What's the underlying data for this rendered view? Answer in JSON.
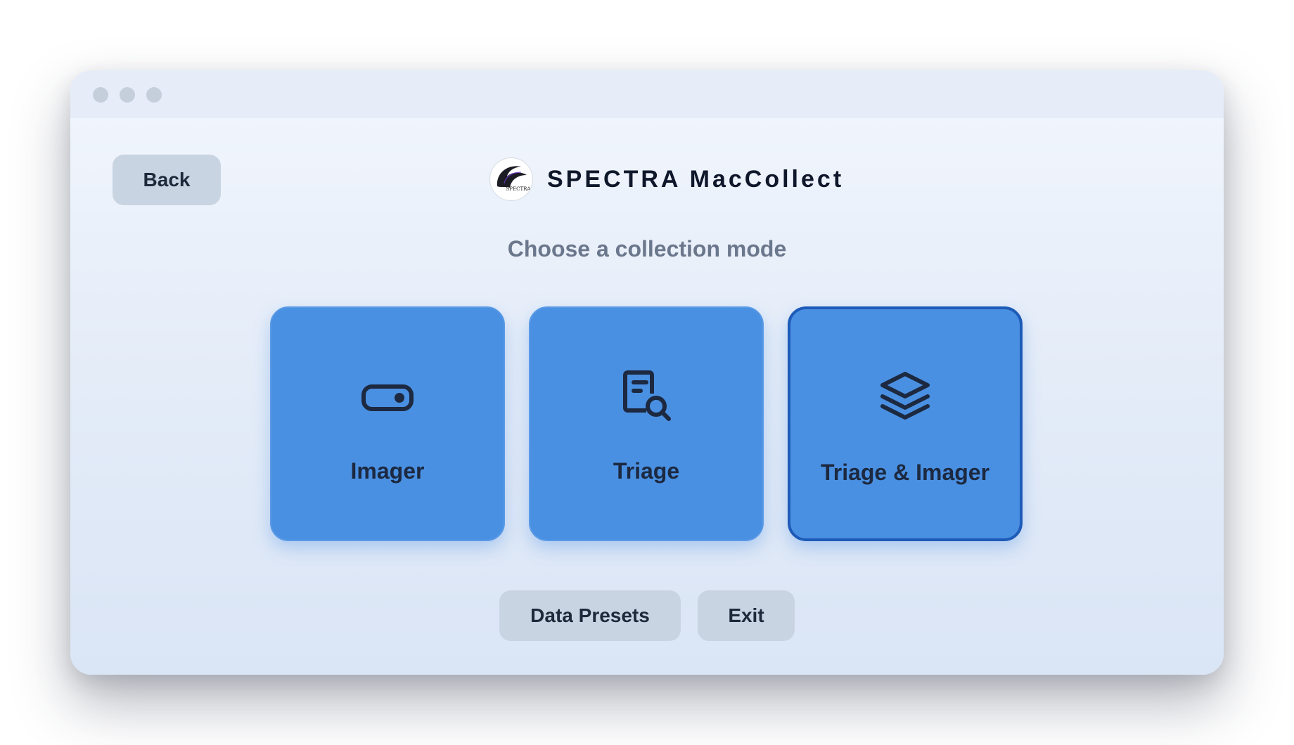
{
  "window": {
    "traffic_lights": [
      "close-dot",
      "minimize-dot",
      "zoom-dot"
    ]
  },
  "header": {
    "back_label": "Back",
    "logo_text": "SPECTRA",
    "app_title": "SPECTRA MacCollect"
  },
  "main": {
    "subtitle": "Choose a collection mode",
    "modes": [
      {
        "label": "Imager",
        "icon": "drive-icon",
        "selected": false
      },
      {
        "label": "Triage",
        "icon": "document-search-icon",
        "selected": false
      },
      {
        "label": "Triage & Imager",
        "icon": "layers-icon",
        "selected": true
      }
    ]
  },
  "footer": {
    "presets_label": "Data Presets",
    "exit_label": "Exit"
  },
  "colors": {
    "card_bg": "#4a90e2",
    "card_selected_border": "#1e5bb8",
    "button_bg": "#c9d4e2",
    "title_text": "#0f172a",
    "subtitle_text": "#6b778c"
  }
}
